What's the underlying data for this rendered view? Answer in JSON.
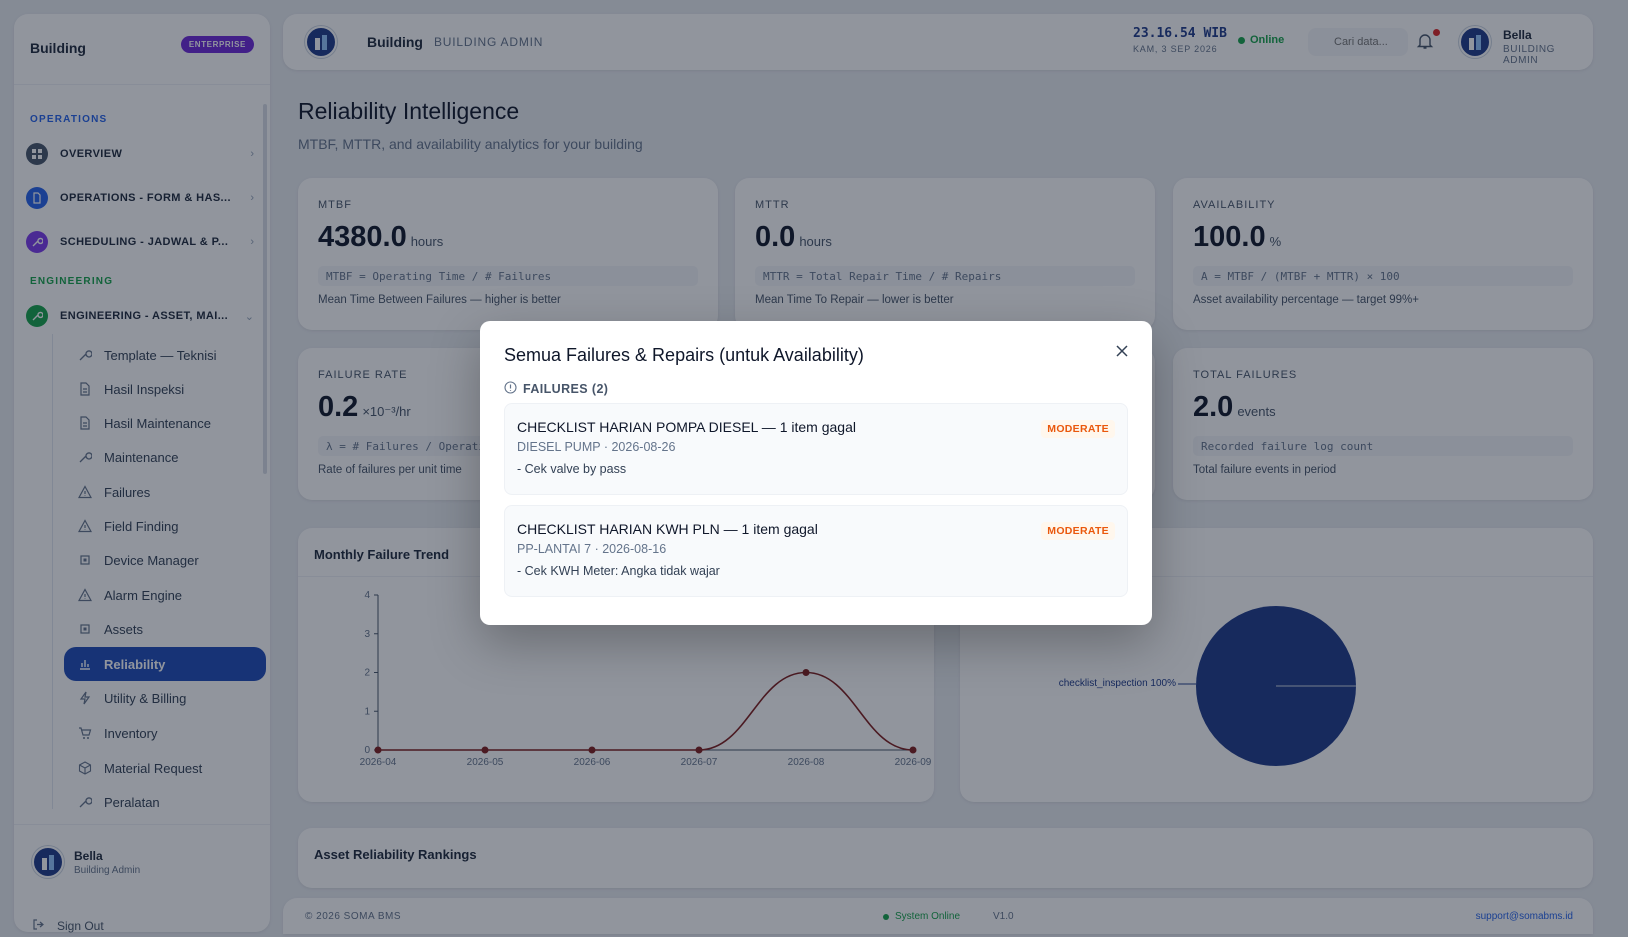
{
  "sidebar": {
    "brand": "Building",
    "badge": "ENTERPRISE",
    "sections": {
      "operations": "OPERATIONS",
      "engineering": "ENGINEERING"
    },
    "top_items": [
      {
        "label": "OVERVIEW"
      },
      {
        "label": "OPERATIONS - FORM & HAS..."
      },
      {
        "label": "SCHEDULING - JADWAL & P..."
      },
      {
        "label": "ENGINEERING - ASSET, MAI..."
      }
    ],
    "sub_items": [
      {
        "label": "Template — Teknisi"
      },
      {
        "label": "Hasil Inspeksi"
      },
      {
        "label": "Hasil Maintenance"
      },
      {
        "label": "Maintenance"
      },
      {
        "label": "Failures"
      },
      {
        "label": "Field Finding"
      },
      {
        "label": "Device Manager"
      },
      {
        "label": "Alarm Engine"
      },
      {
        "label": "Assets"
      },
      {
        "label": "Reliability"
      },
      {
        "label": "Utility & Billing"
      },
      {
        "label": "Inventory"
      },
      {
        "label": "Material Request"
      },
      {
        "label": "Peralatan"
      }
    ],
    "user": {
      "name": "Bella",
      "role": "Building Admin"
    },
    "sign_out": "Sign Out"
  },
  "header": {
    "title": "Building",
    "role": "BUILDING ADMIN",
    "time": "23.16.54 WIB",
    "date": "KAM, 3 SEP 2026",
    "status": "Online",
    "search_placeholder": "Cari data...",
    "user_name": "Bella",
    "user_role": "BUILDING ADMIN"
  },
  "page": {
    "title": "Reliability Intelligence",
    "subtitle": "MTBF, MTTR, and availability analytics for your building"
  },
  "metrics": [
    {
      "label": "MTBF",
      "value": "4380.0",
      "unit": "hours",
      "formula": "MTBF = Operating Time / # Failures",
      "desc": "Mean Time Between Failures — higher is better"
    },
    {
      "label": "MTTR",
      "value": "0.0",
      "unit": "hours",
      "formula": "MTTR = Total Repair Time / # Repairs",
      "desc": "Mean Time To Repair — lower is better"
    },
    {
      "label": "AVAILABILITY",
      "value": "100.0",
      "unit": "%",
      "formula": "A = MTBF / (MTBF + MTTR) × 100",
      "desc": "Asset availability percentage — target 99%+"
    },
    {
      "label": "FAILURE RATE",
      "value": "0.2",
      "unit": "×10⁻³/hr",
      "formula": "λ = # Failures / Operating Time",
      "desc": "Rate of failures per unit time"
    },
    {
      "label": "TOTAL FAILURES",
      "value": "2.0",
      "unit": "events",
      "formula": "Recorded failure log count",
      "desc": "Total failure events in period"
    }
  ],
  "trend_card": {
    "title": "Monthly Failure Trend"
  },
  "rankings_card": {
    "title": "Asset Reliability Rankings"
  },
  "chart_data": [
    {
      "type": "line",
      "title": "Monthly Failure Trend",
      "x": [
        "2026-04",
        "2026-05",
        "2026-06",
        "2026-07",
        "2026-08",
        "2026-09"
      ],
      "values": [
        0,
        0,
        0,
        0,
        2,
        0
      ],
      "ylim": [
        0,
        4
      ],
      "yticks": [
        "0",
        "1",
        "2",
        "3",
        "4"
      ],
      "color": "#7f1d1d"
    },
    {
      "type": "pie",
      "labels": [
        "checklist_inspection"
      ],
      "values": [
        100
      ],
      "slice_labels": [
        "checklist_inspection 100%"
      ],
      "color": "#1e3a8a"
    }
  ],
  "footer": {
    "copyright": "© 2026 SOMA BMS",
    "status": "System Online",
    "version": "V1.0",
    "email": "support@somabms.id"
  },
  "modal": {
    "title": "Semua Failures & Repairs (untuk Availability)",
    "section": "FAILURES (2)",
    "items": [
      {
        "title": "CHECKLIST HARIAN POMPA DIESEL — 1 item gagal",
        "meta": "DIESEL PUMP · 2026-08-26",
        "detail": "- Cek valve by pass",
        "badge": "MODERATE"
      },
      {
        "title": "CHECKLIST HARIAN KWH PLN — 1 item gagal",
        "meta": "PP-LANTAI 7 · 2026-08-16",
        "detail": "- Cek KWH Meter: Angka tidak wajar",
        "badge": "MODERATE"
      }
    ]
  },
  "colors": {
    "accent": "#1e4bb8",
    "online": "#16a34a",
    "moderate": "#ea580c",
    "operations_section": "#2563eb",
    "engineering_section": "#16a34a"
  }
}
